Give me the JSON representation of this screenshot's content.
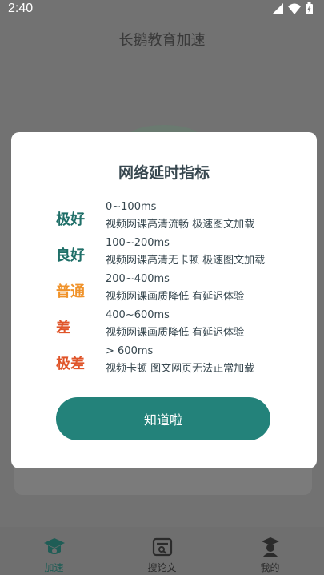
{
  "status_bar": {
    "time": "2:40"
  },
  "app_title": "长鹅教育加速",
  "dialog": {
    "title": "网络延时指标",
    "rows": [
      {
        "level": "极好",
        "color": "#1f6f68",
        "range": "0~100ms",
        "desc": "视频网课高清流畅 极速图文加载"
      },
      {
        "level": "良好",
        "color": "#1f6f68",
        "range": "100~200ms",
        "desc": "视频网课高清无卡顿 极速图文加载"
      },
      {
        "level": "普通",
        "color": "#f0932b",
        "range": "200~400ms",
        "desc": "视频网课画质降低 有延迟体验"
      },
      {
        "level": "差",
        "color": "#e0552a",
        "range": "400~600ms",
        "desc": "视频网课画质降低 有延迟体验"
      },
      {
        "level": "极差",
        "color": "#e0552a",
        "range": "> 600ms",
        "desc": "视频卡顿 图文网页无法正常加载"
      }
    ],
    "button_label": "知道啦"
  },
  "bottom_nav": {
    "items": [
      {
        "label": "加速",
        "icon": "graduation-cap-icon",
        "active": true
      },
      {
        "label": "搜论文",
        "icon": "search-paper-icon",
        "active": false
      },
      {
        "label": "我的",
        "icon": "profile-icon",
        "active": false
      }
    ]
  },
  "colors": {
    "accent": "#23827a",
    "scrim": "#727272"
  }
}
